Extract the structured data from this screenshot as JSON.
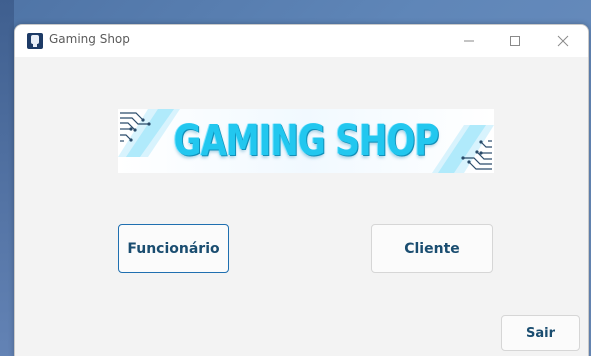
{
  "window": {
    "title": "Gaming Shop",
    "app_icon": "app-icon"
  },
  "title_controls": {
    "minimize_icon": "minimize-icon",
    "maximize_icon": "maximize-icon",
    "close_icon": "close-icon"
  },
  "banner": {
    "text": "GAMING SHOP",
    "color": "#22c7ef"
  },
  "buttons": {
    "funcionario": "Funcionário",
    "cliente": "Cliente",
    "sair": "Sair"
  },
  "colors": {
    "accent": "#1f6fb0",
    "button_text": "#1a4d70",
    "window_bg": "#f3f3f3"
  }
}
